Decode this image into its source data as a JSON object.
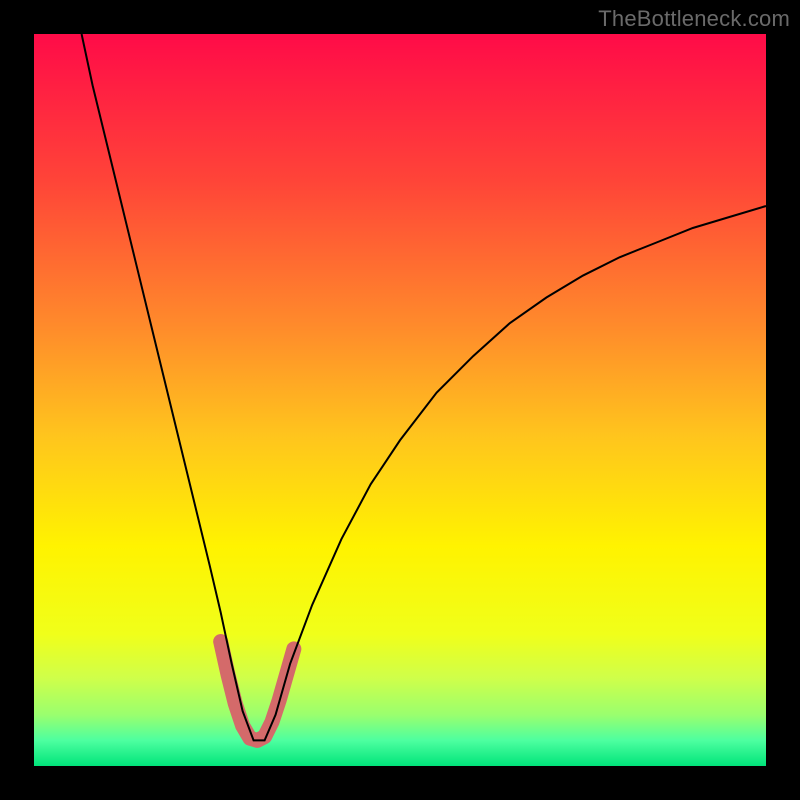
{
  "watermark": "TheBottleneck.com",
  "chart_data": {
    "type": "line",
    "title": "",
    "xlabel": "",
    "ylabel": "",
    "xlim": [
      0,
      100
    ],
    "ylim": [
      0,
      100
    ],
    "axes_visible": false,
    "grid": false,
    "background_gradient": {
      "stops": [
        {
          "offset": 0.0,
          "color": "#ff0b48"
        },
        {
          "offset": 0.2,
          "color": "#ff4438"
        },
        {
          "offset": 0.4,
          "color": "#ff8b2b"
        },
        {
          "offset": 0.55,
          "color": "#ffc51d"
        },
        {
          "offset": 0.7,
          "color": "#fff300"
        },
        {
          "offset": 0.82,
          "color": "#f0ff1a"
        },
        {
          "offset": 0.88,
          "color": "#cfff4a"
        },
        {
          "offset": 0.93,
          "color": "#9aff6e"
        },
        {
          "offset": 0.965,
          "color": "#4dffa0"
        },
        {
          "offset": 1.0,
          "color": "#00e47a"
        }
      ]
    },
    "curve_minimum_x": 30,
    "series": [
      {
        "name": "bottleneck-curve",
        "stroke": "#000000",
        "stroke_width": 2,
        "data": [
          {
            "x": 6.5,
            "y": 100.0
          },
          {
            "x": 8.0,
            "y": 93.0
          },
          {
            "x": 10.0,
            "y": 84.8
          },
          {
            "x": 12.0,
            "y": 76.6
          },
          {
            "x": 14.0,
            "y": 68.4
          },
          {
            "x": 16.0,
            "y": 60.2
          },
          {
            "x": 18.0,
            "y": 52.0
          },
          {
            "x": 20.0,
            "y": 43.8
          },
          {
            "x": 22.0,
            "y": 35.6
          },
          {
            "x": 24.0,
            "y": 27.4
          },
          {
            "x": 25.5,
            "y": 21.0
          },
          {
            "x": 27.0,
            "y": 14.0
          },
          {
            "x": 28.5,
            "y": 7.5
          },
          {
            "x": 30.0,
            "y": 3.5
          },
          {
            "x": 31.5,
            "y": 3.5
          },
          {
            "x": 33.0,
            "y": 7.0
          },
          {
            "x": 35.0,
            "y": 14.0
          },
          {
            "x": 38.0,
            "y": 22.0
          },
          {
            "x": 42.0,
            "y": 31.0
          },
          {
            "x": 46.0,
            "y": 38.5
          },
          {
            "x": 50.0,
            "y": 44.5
          },
          {
            "x": 55.0,
            "y": 51.0
          },
          {
            "x": 60.0,
            "y": 56.0
          },
          {
            "x": 65.0,
            "y": 60.5
          },
          {
            "x": 70.0,
            "y": 64.0
          },
          {
            "x": 75.0,
            "y": 67.0
          },
          {
            "x": 80.0,
            "y": 69.5
          },
          {
            "x": 85.0,
            "y": 71.5
          },
          {
            "x": 90.0,
            "y": 73.5
          },
          {
            "x": 95.0,
            "y": 75.0
          },
          {
            "x": 100.0,
            "y": 76.5
          }
        ]
      },
      {
        "name": "trough-highlight",
        "stroke": "#d46a6a",
        "stroke_width": 15,
        "linecap": "round",
        "data": [
          {
            "x": 25.5,
            "y": 17.0
          },
          {
            "x": 26.5,
            "y": 12.5
          },
          {
            "x": 27.5,
            "y": 8.5
          },
          {
            "x": 28.5,
            "y": 5.5
          },
          {
            "x": 29.5,
            "y": 3.8
          },
          {
            "x": 30.5,
            "y": 3.5
          },
          {
            "x": 31.5,
            "y": 4.0
          },
          {
            "x": 32.5,
            "y": 6.0
          },
          {
            "x": 33.5,
            "y": 9.0
          },
          {
            "x": 34.5,
            "y": 12.5
          },
          {
            "x": 35.5,
            "y": 16.0
          }
        ]
      }
    ]
  }
}
